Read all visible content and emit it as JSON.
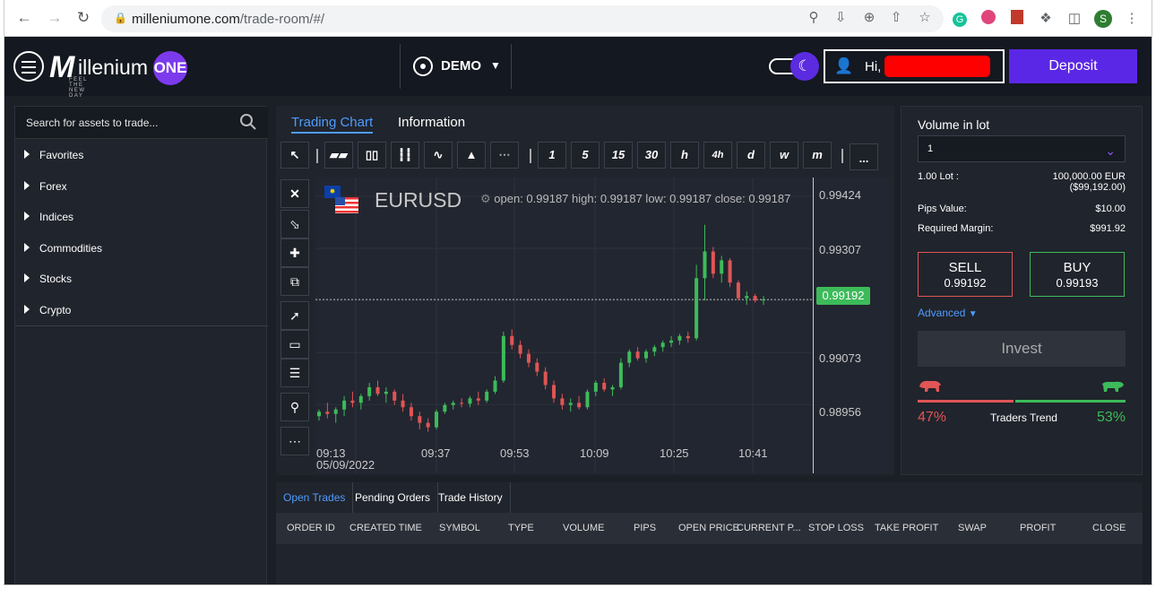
{
  "browser": {
    "url_host": "milleniumone.com",
    "url_path": "/trade-room/#/",
    "profile_initial": "S"
  },
  "header": {
    "logo_main": "illenium",
    "logo_one": "ONE",
    "logo_tag": "FEEL THE NEW DAY",
    "mode": "DEMO",
    "greeting": "Hi,",
    "deposit_label": "Deposit"
  },
  "left": {
    "search_placeholder": "Search for assets to trade...",
    "categories": [
      "Favorites",
      "Forex",
      "Indices",
      "Commodities",
      "Stocks",
      "Crypto"
    ]
  },
  "chart": {
    "tabs": [
      "Trading Chart",
      "Information"
    ],
    "intervals": [
      "1",
      "5",
      "15",
      "30",
      "h",
      "4h",
      "d",
      "w",
      "m"
    ],
    "more_label": "...",
    "symbol": "EURUSD",
    "ohlc_text": "open: 0.99187 high: 0.99187 low: 0.99187 close: 0.99187",
    "current_price": "0.99192",
    "y_ticks": [
      "0.99424",
      "0.99307",
      "0.99073",
      "0.98956"
    ],
    "x_ticks": [
      "09:13",
      "09:37",
      "09:53",
      "10:09",
      "10:25",
      "10:41"
    ],
    "x_date": "05/09/2022",
    "colors": {
      "up": "#3dbb5a",
      "down": "#e05555"
    }
  },
  "chart_data": {
    "type": "candlestick",
    "x": [
      "09:13",
      "09:37",
      "09:53",
      "10:09",
      "10:25",
      "10:41"
    ],
    "ylim": [
      0.9887,
      0.9945
    ],
    "current": 0.99192,
    "candles": [
      [
        0.9893,
        0.98945,
        0.9892,
        0.9894
      ],
      [
        0.9894,
        0.9896,
        0.98925,
        0.98935
      ],
      [
        0.98935,
        0.9895,
        0.98915,
        0.98945
      ],
      [
        0.98945,
        0.98975,
        0.9893,
        0.98965
      ],
      [
        0.98965,
        0.98985,
        0.9895,
        0.9896
      ],
      [
        0.9896,
        0.9898,
        0.98945,
        0.98975
      ],
      [
        0.98975,
        0.99005,
        0.98965,
        0.98995
      ],
      [
        0.98995,
        0.9901,
        0.98975,
        0.9898
      ],
      [
        0.9898,
        0.98995,
        0.9896,
        0.98985
      ],
      [
        0.98985,
        0.9899,
        0.98955,
        0.98965
      ],
      [
        0.98965,
        0.9898,
        0.9894,
        0.9895
      ],
      [
        0.9895,
        0.9896,
        0.9892,
        0.9893
      ],
      [
        0.9893,
        0.9894,
        0.989,
        0.98915
      ],
      [
        0.98915,
        0.98925,
        0.98895,
        0.98905
      ],
      [
        0.98905,
        0.98945,
        0.989,
        0.9894
      ],
      [
        0.9894,
        0.9896,
        0.98935,
        0.98955
      ],
      [
        0.98955,
        0.98965,
        0.98945,
        0.9896
      ],
      [
        0.9896,
        0.9897,
        0.9895,
        0.98958
      ],
      [
        0.98958,
        0.98975,
        0.9895,
        0.9897
      ],
      [
        0.9897,
        0.98985,
        0.98955,
        0.98965
      ],
      [
        0.98965,
        0.9899,
        0.9896,
        0.98985
      ],
      [
        0.98985,
        0.9902,
        0.9898,
        0.9901
      ],
      [
        0.9901,
        0.9912,
        0.99005,
        0.9911
      ],
      [
        0.9911,
        0.99125,
        0.9908,
        0.9909
      ],
      [
        0.9909,
        0.991,
        0.9906,
        0.9907
      ],
      [
        0.9907,
        0.9908,
        0.9904,
        0.9905
      ],
      [
        0.9905,
        0.9906,
        0.9902,
        0.9903
      ],
      [
        0.9903,
        0.9904,
        0.9899,
        0.99
      ],
      [
        0.99,
        0.9901,
        0.9896,
        0.9897
      ],
      [
        0.9897,
        0.9898,
        0.98945,
        0.98955
      ],
      [
        0.98955,
        0.9897,
        0.9894,
        0.9896
      ],
      [
        0.9896,
        0.98975,
        0.98945,
        0.9895
      ],
      [
        0.9895,
        0.9899,
        0.98945,
        0.98985
      ],
      [
        0.98985,
        0.9901,
        0.98975,
        0.99005
      ],
      [
        0.99005,
        0.99015,
        0.98985,
        0.9899
      ],
      [
        0.9899,
        0.99,
        0.98975,
        0.98995
      ],
      [
        0.98995,
        0.9906,
        0.9899,
        0.9905
      ],
      [
        0.9905,
        0.9908,
        0.9904,
        0.99075
      ],
      [
        0.99075,
        0.99085,
        0.99055,
        0.9906
      ],
      [
        0.9906,
        0.9908,
        0.9905,
        0.99075
      ],
      [
        0.99075,
        0.9909,
        0.99065,
        0.99085
      ],
      [
        0.99085,
        0.991,
        0.99075,
        0.99095
      ],
      [
        0.99095,
        0.9911,
        0.99085,
        0.991
      ],
      [
        0.991,
        0.99115,
        0.9909,
        0.9911
      ],
      [
        0.9911,
        0.9912,
        0.99095,
        0.99105
      ],
      [
        0.99105,
        0.9927,
        0.991,
        0.9924
      ],
      [
        0.9924,
        0.9936,
        0.9919,
        0.993
      ],
      [
        0.993,
        0.9931,
        0.9924,
        0.9925
      ],
      [
        0.9925,
        0.9929,
        0.9923,
        0.9928
      ],
      [
        0.9928,
        0.99285,
        0.9922,
        0.9923
      ],
      [
        0.9923,
        0.99235,
        0.9919,
        0.99195
      ],
      [
        0.99195,
        0.9921,
        0.9918,
        0.992
      ],
      [
        0.992,
        0.99205,
        0.99185,
        0.9919
      ],
      [
        0.9919,
        0.992,
        0.9918,
        0.99192
      ]
    ]
  },
  "right": {
    "volume_label": "Volume in lot",
    "volume_value": "1",
    "lot_label": "1.00 Lot :",
    "lot_value": "100,000.00 EUR",
    "lot_value2": "($99,192.00)",
    "pips_label": "Pips Value:",
    "pips_value": "$10.00",
    "margin_label": "Required Margin:",
    "margin_value": "$991.92",
    "sell_label": "SELL",
    "sell_price": "0.99192",
    "buy_label": "BUY",
    "buy_price": "0.99193",
    "advanced_label": "Advanced",
    "invest_label": "Invest",
    "sell_pct": "47%",
    "buy_pct": "53%",
    "trend_label": "Traders Trend",
    "sell_fraction": 0.47
  },
  "bottom": {
    "tabs": [
      "Open Trades",
      "Pending Orders",
      "Trade History"
    ],
    "columns": [
      "ORDER ID",
      "CREATED TIME",
      "SYMBOL",
      "TYPE",
      "VOLUME",
      "PIPS",
      "OPEN PRICE",
      "CURRENT P...",
      "STOP LOSS",
      "TAKE PROFIT",
      "SWAP",
      "PROFIT",
      "CLOSE"
    ]
  }
}
